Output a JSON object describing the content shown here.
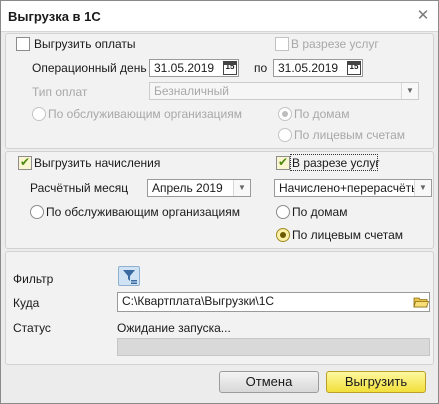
{
  "window": {
    "title": "Выгрузка в 1С"
  },
  "payments": {
    "export_label": "Выгрузить оплаты",
    "by_service_label": "В разрезе услуг",
    "op_day_label": "Операционный день",
    "date_from": "31.05.2019",
    "to_label": "по",
    "date_to": "31.05.2019",
    "cal_icon_text": "15",
    "pay_type_label": "Тип оплат",
    "pay_type_value": "Безналичный",
    "by_org_label": "По обслуживающим организациям",
    "by_house_label": "По домам",
    "by_account_label": "По лицевым счетам"
  },
  "charges": {
    "export_label": "Выгрузить начисления",
    "by_service_label": "В разрезе услуг",
    "month_label": "Расчётный месяц",
    "month_value": "Апрель 2019",
    "calc_value": "Начислено+перерасчёты",
    "by_org_label": "По обслуживающим организациям",
    "by_house_label": "По домам",
    "by_account_label": "По лицевым счетам"
  },
  "bottom": {
    "filter_label": "Фильтр",
    "dest_label": "Куда",
    "dest_value": "C:\\Квартплата\\Выгрузки\\1С",
    "status_label": "Статус",
    "status_value": "Ожидание запуска...",
    "progress": 0
  },
  "buttons": {
    "cancel": "Отмена",
    "export": "Выгрузить"
  }
}
